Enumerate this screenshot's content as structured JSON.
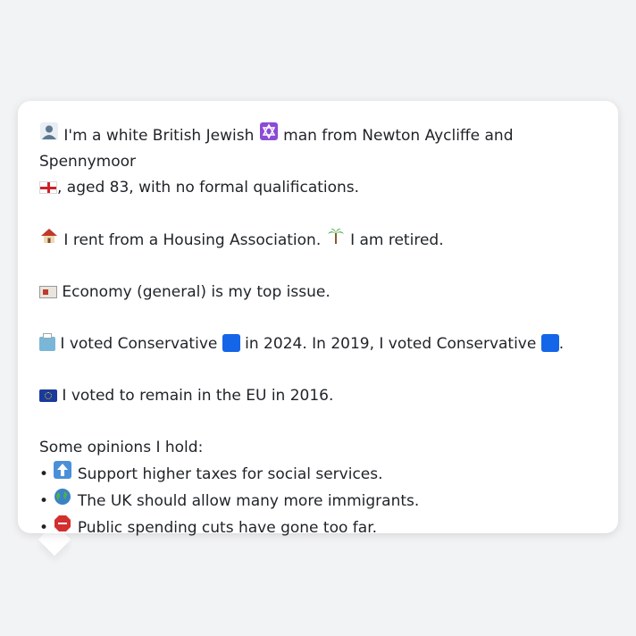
{
  "profile": {
    "line1_part1": "I'm a white British Jewish",
    "line1_part2": "man from Newton Aycliffe and Spennymoor",
    "line1_part3": ", aged 83, with no formal qualifications.",
    "housing": "I rent from a Housing Association.",
    "employment": "I am retired.",
    "top_issue": "Economy (general) is my top issue.",
    "vote_part1": "I voted Conservative",
    "vote_part2": "in 2024. In 2019, I voted Conservative",
    "vote_part3": ".",
    "eu": "I voted to remain in the EU in 2016.",
    "opinions_heading": "Some opinions I hold:",
    "opinions": [
      "Support higher taxes for social services.",
      "The UK should allow many more immigrants.",
      "Public spending cuts have gone too far."
    ]
  },
  "icons": {
    "person": "person-silhouette-icon",
    "religion": "star-of-david-icon",
    "region": "england-flag-icon",
    "housing": "house-icon",
    "employment": "palm-tree-icon",
    "issue": "newspaper-icon",
    "vote": "ballot-box-icon",
    "party": "blue-square-icon",
    "eu": "eu-flag-icon",
    "opinion1": "up-arrow-icon",
    "opinion2": "globe-icon",
    "opinion3": "stop-sign-icon"
  },
  "colors": {
    "background": "#f2f3f5",
    "bubble": "#ffffff",
    "text": "#1f2328",
    "conservative_blue": "#1565e8",
    "star_purple": "#8a4bd6"
  }
}
